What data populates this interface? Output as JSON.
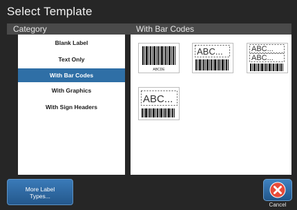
{
  "dialog": {
    "title": "Select Template"
  },
  "headers": {
    "category": "Category",
    "templates": "With Bar Codes"
  },
  "categories": [
    {
      "label": "Blank Label",
      "selected": false
    },
    {
      "label": "Text Only",
      "selected": false
    },
    {
      "label": "With Bar Codes",
      "selected": true
    },
    {
      "label": "With Graphics",
      "selected": false
    },
    {
      "label": "With Sign Headers",
      "selected": false
    }
  ],
  "templates": [
    {
      "name": "barcode-only",
      "caption": "ABCDE",
      "icon": "barcode-template-icon"
    },
    {
      "name": "text-barcode",
      "text": "ABC...",
      "icon": "text-barcode-template-icon"
    },
    {
      "name": "two-text-barcode",
      "text1": "ABC...",
      "text2": "ABC...",
      "icon": "two-text-barcode-template-icon"
    },
    {
      "name": "text-barcode-large",
      "text": "ABC...",
      "icon": "text-barcode-large-template-icon"
    }
  ],
  "buttons": {
    "more_label_types": "More Label\nTypes...",
    "cancel": "Cancel"
  },
  "colors": {
    "background": "#262626",
    "header_bar": "#4a4a4a",
    "selected": "#2f6fa6",
    "button": "#2f6fa6",
    "cancel_icon": "#e84b3a"
  }
}
